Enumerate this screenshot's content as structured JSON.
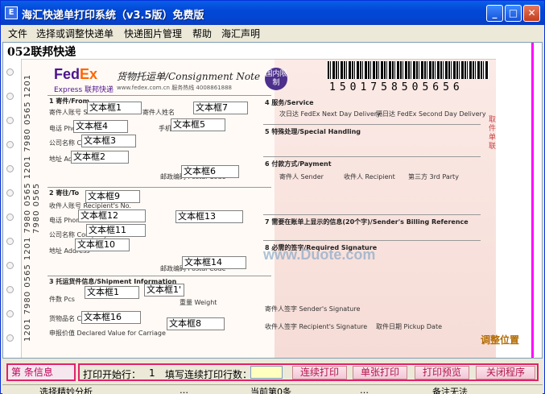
{
  "window": {
    "title": "海汇快递单打印系统（v3.5版）免费版",
    "app_icon_glyph": "E",
    "minimize_glyph": "_",
    "maximize_glyph": "□",
    "close_glyph": "✕"
  },
  "menu": [
    "文件",
    "选择或调整快递单",
    "快递图片管理",
    "帮助",
    "海汇声明"
  ],
  "template": {
    "name": "052联邦快递",
    "side_code": "1201 7980 0565 1201 7980 0565 1201 7980 0565 1201 7980 0565",
    "logo_fed": "Fed",
    "logo_ex": "Ex",
    "logo_sub": "Express  联邦快递",
    "doc_title": "货物托运单/Consignment Note",
    "doc_sub": "www.fedex.com.cn    服务热线 4008861888",
    "intl_badge": "国内限制",
    "barcode_number": "1501758505656",
    "right_vertical": "取件单联",
    "watermark": "www.Duote.com",
    "sections_left": [
      "1  寄件/From",
      "2  寄往/To",
      "3  托运货件信息/Shipment Information"
    ],
    "sections_right": [
      "4  服务/Service",
      "5  特殊处理/Special Handling",
      "6  付款方式/Payment",
      "7  需要在账单上显示的信息(20个字)/Sender's Billing Reference",
      "8  必需的签字/Required Signature"
    ],
    "labels_left": [
      "寄件人账号 Sender's Acct. No.",
      "电话 Phone",
      "公司名称 Company",
      "地址 Address",
      "邮政编码 Postal Code",
      "收件人账号 Recipient's No.",
      "电话 Phone",
      "公司名称 Company",
      "地址 Address",
      "邮政编码 Postal Code",
      "件数 Pcs",
      "货物品名 Commodity",
      "申报价值 Declared Value for Carriage",
      "寄件人姓名",
      "手机 Mobile",
      "重量 Weight"
    ],
    "labels_right": [
      "次日达 FedEx Next Day Delivery",
      "隔日达 FedEx Second Day Delivery",
      "寄件人 Sender",
      "收件人 Recipient",
      "第三方 3rd Party",
      "寄件人签字 Sender's Signature",
      "收件人签字 Recipient's Signature",
      "取件日期 Pickup Date"
    ],
    "text_boxes": [
      "文本框1",
      "文本框7",
      "文本框4",
      "文本框5",
      "文本框3",
      "文本框2",
      "文本框6",
      "文本框9",
      "文本框12",
      "文本框13",
      "文本框11",
      "文本框10",
      "文本框14",
      "文本框1",
      "文本框1'",
      "文本框16",
      "文本框8"
    ]
  },
  "bottom": {
    "record_info": "第      条信息",
    "start_row_label": "打印开始行：",
    "start_row_value": "1",
    "continuous_rows_label": "填写连续打印行数：",
    "buttons": [
      "连续打印",
      "单张打印",
      "打印预览",
      "关闭程序"
    ],
    "floating_note": "调整位置"
  },
  "status": [
    "选择精妙分析",
    "…",
    "当前第0条",
    "…",
    "备注无法"
  ],
  "colors": {
    "accent": "#e0226a",
    "titlebar": "#0347d6",
    "fedex_purple": "#4d148c",
    "fedex_orange": "#ff6600"
  }
}
